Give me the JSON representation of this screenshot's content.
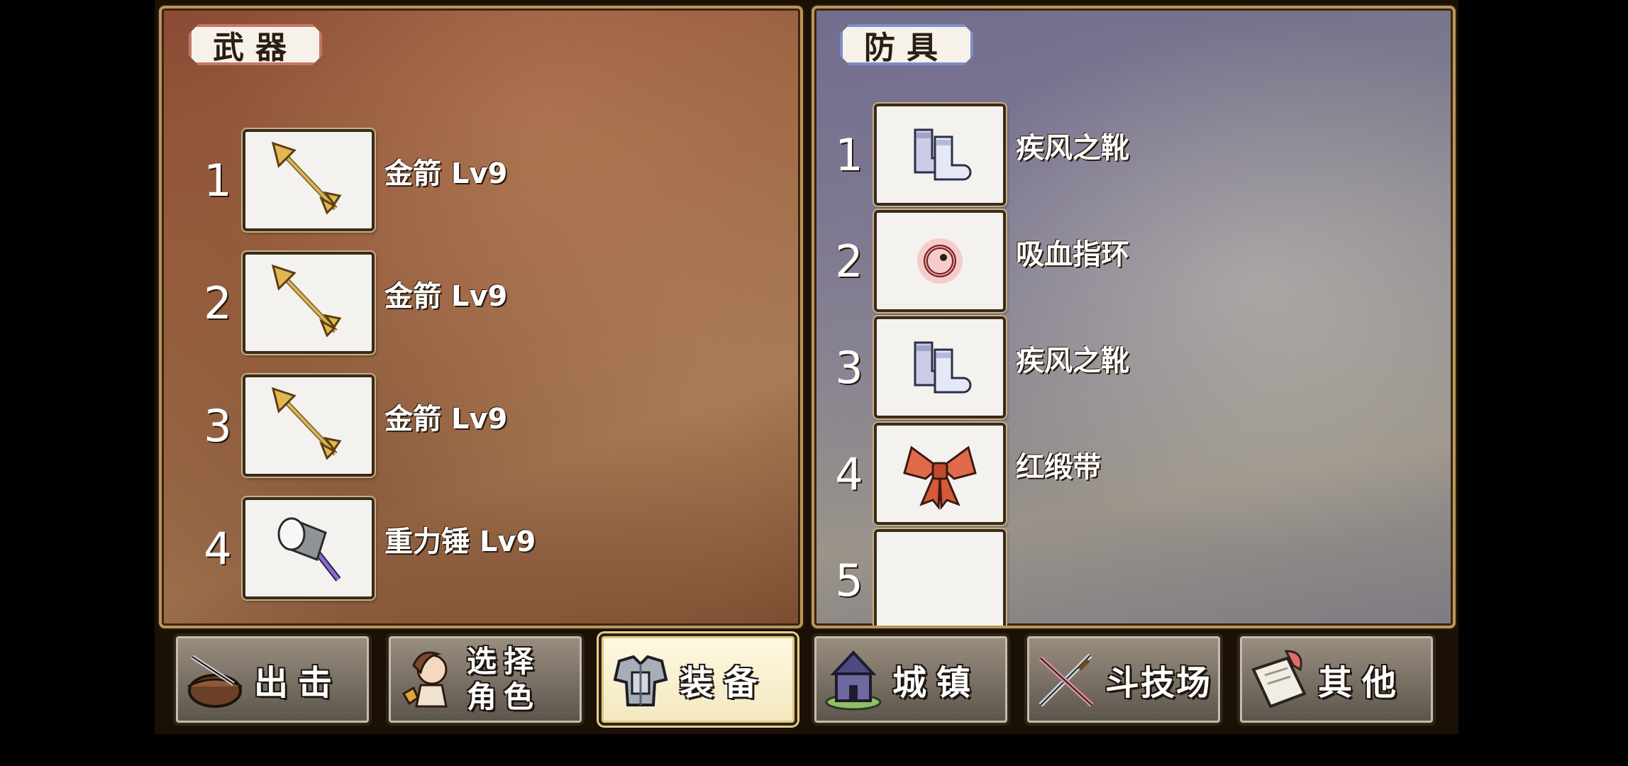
{
  "weapons": {
    "title": "武器",
    "slots": [
      {
        "number": "1",
        "icon": "gold-arrow-icon",
        "label": "金箭 Lv9"
      },
      {
        "number": "2",
        "icon": "gold-arrow-icon",
        "label": "金箭 Lv9"
      },
      {
        "number": "3",
        "icon": "gold-arrow-icon",
        "label": "金箭 Lv9"
      },
      {
        "number": "4",
        "icon": "gravity-hammer-icon",
        "label": "重力锤 Lv9"
      }
    ]
  },
  "armor": {
    "title": "防具",
    "slots": [
      {
        "number": "1",
        "icon": "gale-boots-icon",
        "label": "疾风之靴"
      },
      {
        "number": "2",
        "icon": "vampire-ring-icon",
        "label": "吸血指环"
      },
      {
        "number": "3",
        "icon": "gale-boots-icon",
        "label": "疾风之靴"
      },
      {
        "number": "4",
        "icon": "red-ribbon-icon",
        "label": "红缎带"
      },
      {
        "number": "5",
        "icon": "",
        "label": ""
      }
    ]
  },
  "nav": {
    "sortie": "出击",
    "select_character": "选择角色",
    "equipment": "装备",
    "town": "城镇",
    "arena": "斗技场",
    "other": "其他",
    "active": "equipment"
  },
  "colors": {
    "weapon_panel": "#9c6442",
    "armor_panel": "#8a8790",
    "panel_border": "#b9975a",
    "weapon_header_border": "#c6746b",
    "armor_header_border": "#7c8ec9"
  }
}
